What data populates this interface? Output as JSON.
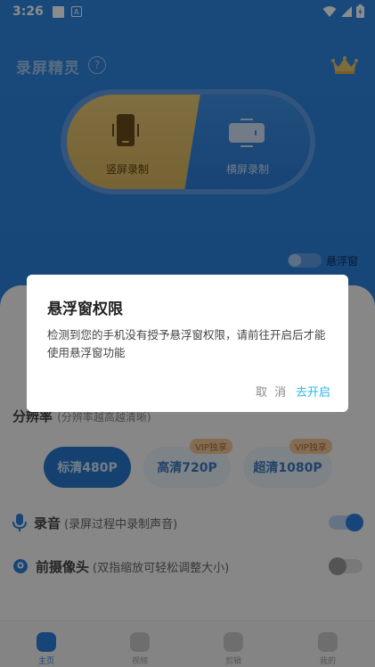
{
  "status_bar": {
    "time": "3:26"
  },
  "app": {
    "title": "录屏精灵"
  },
  "modes": {
    "portrait": "竖屏录制",
    "landscape": "横屏录制"
  },
  "floating": {
    "label": "悬浮窗"
  },
  "resolution": {
    "title": "分辨率",
    "subtitle": "(分辨率越高越清晰)",
    "options": [
      {
        "label": "标清480P",
        "selected": true
      },
      {
        "label": "高清720P",
        "badge": "VIP独享"
      },
      {
        "label": "超清1080P",
        "badge": "VIP独享"
      }
    ]
  },
  "options": {
    "audio": {
      "title": "录音",
      "subtitle": "(录屏过程中录制声音)",
      "enabled": true
    },
    "camera": {
      "title": "前摄像头",
      "subtitle": "(双指缩放可轻松调整大小)",
      "enabled": false
    }
  },
  "tabs": [
    {
      "label": "主页",
      "active": true
    },
    {
      "label": "视频"
    },
    {
      "label": "剪辑"
    },
    {
      "label": "我的"
    }
  ],
  "dialog": {
    "title": "悬浮窗权限",
    "message": "检测到您的手机没有授予悬浮窗权限，请前往开启后才能使用悬浮窗功能",
    "cancel": "取 消",
    "confirm": "去开启"
  },
  "colors": {
    "primary": "#2a7fdb",
    "gold": "#e0bf6a",
    "confirm": "#2bb7e7"
  }
}
